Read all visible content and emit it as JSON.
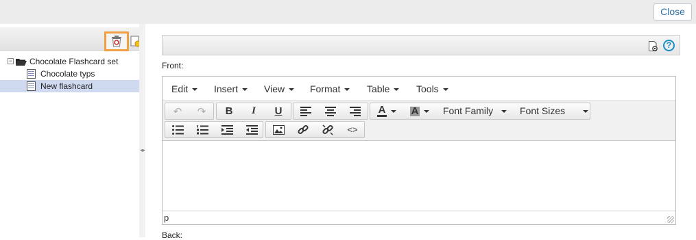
{
  "topbar": {
    "close_label": "Close"
  },
  "tree": {
    "root_label": "Chocolate Flashcard set",
    "children": [
      {
        "label": "Chocolate typs",
        "selected": false
      },
      {
        "label": "New flashcard",
        "selected": true
      }
    ]
  },
  "editor": {
    "front_label": "Front:",
    "back_label": "Back:",
    "menu": [
      "Edit",
      "Insert",
      "View",
      "Format",
      "Table",
      "Tools"
    ],
    "font_family_label": "Font Family",
    "font_sizes_label": "Font Sizes",
    "status_path": "p",
    "accent_color": "#f0a043"
  },
  "icons": {
    "help_glyph": "?"
  }
}
